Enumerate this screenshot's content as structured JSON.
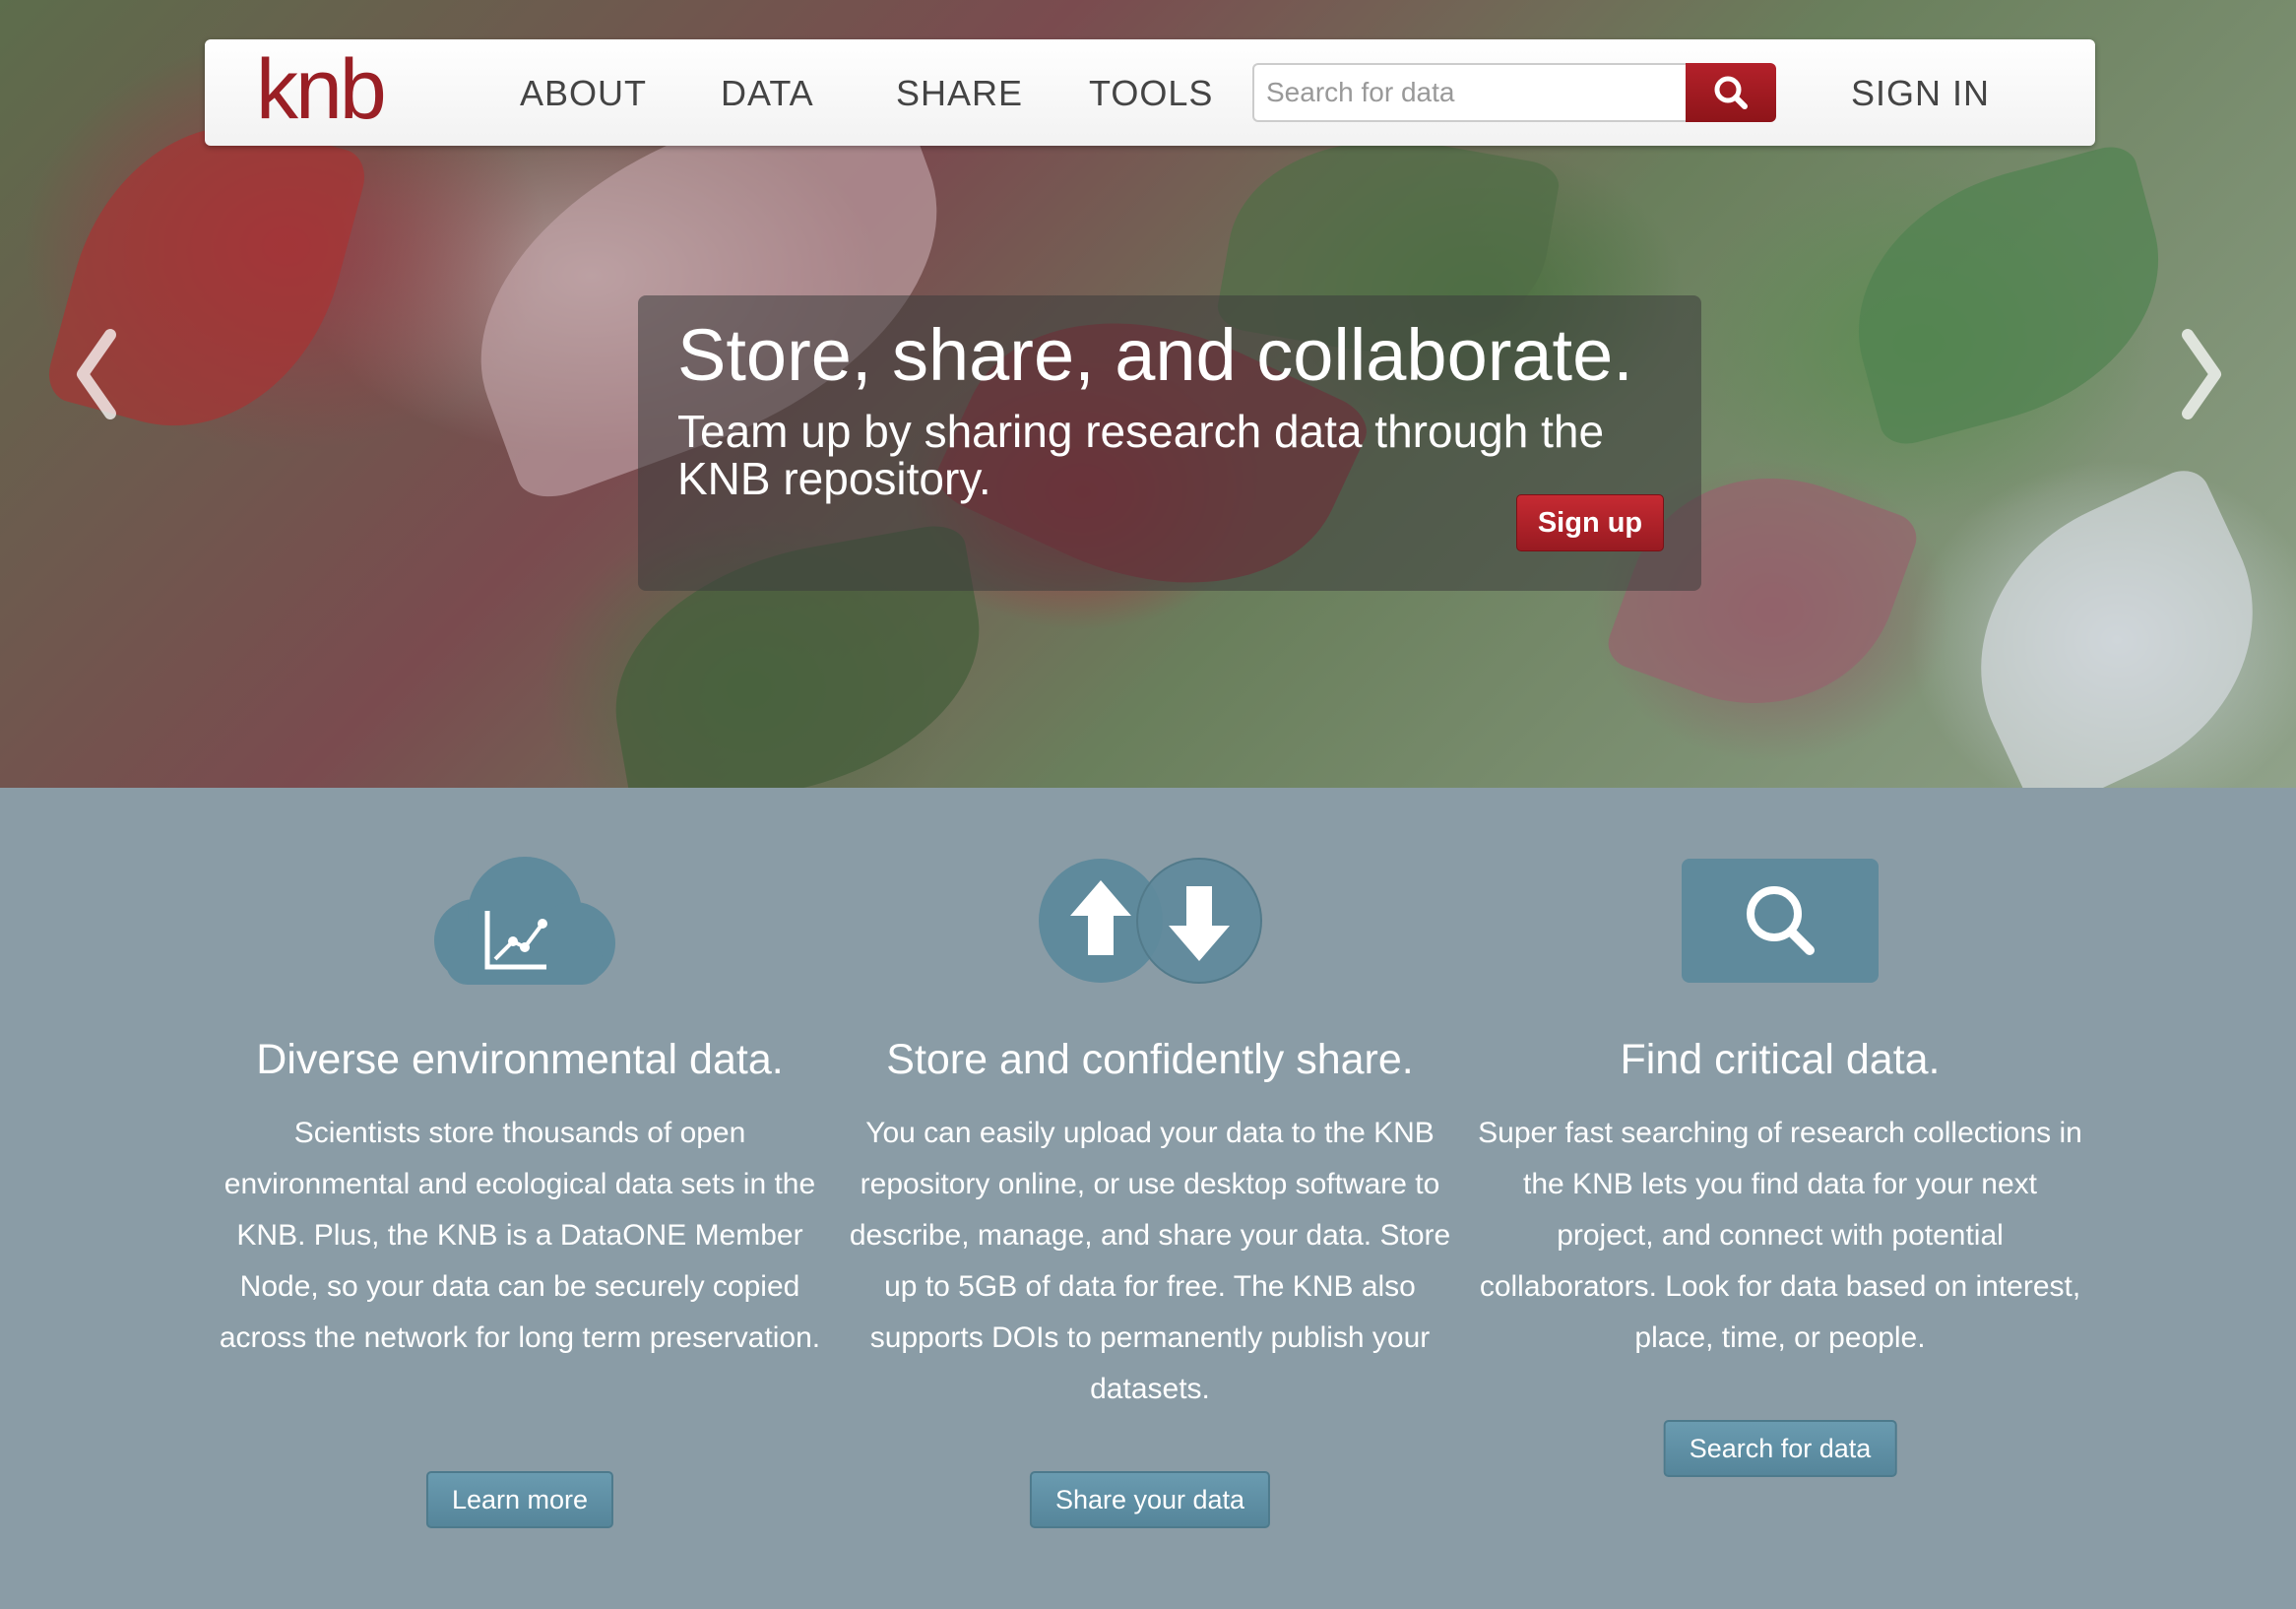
{
  "brand": {
    "logo_text": "knb",
    "accent_color": "#9a1f25"
  },
  "nav": {
    "items": [
      {
        "label": "ABOUT"
      },
      {
        "label": "DATA"
      },
      {
        "label": "SHARE"
      },
      {
        "label": "TOOLS"
      }
    ],
    "search_placeholder": "Search for data",
    "search_icon": "search-icon",
    "sign_in_label": "SIGN IN"
  },
  "hero": {
    "title": "Store, share, and collaborate.",
    "subtitle": "Team up by sharing research data through the KNB repository.",
    "signup_label": "Sign up",
    "prev_icon": "chevron-left-icon",
    "next_icon": "chevron-right-icon"
  },
  "features": [
    {
      "icon": "cloud-chart-icon",
      "title": "Diverse environmental data.",
      "text": "Scientists store thousands of open environmental and ecological data sets in the KNB. Plus, the KNB is a DataONE Member Node, so your data can be securely copied across the network for long term preservation.",
      "button_label": "Learn more"
    },
    {
      "icon": "upload-download-icon",
      "title": "Store and confidently share.",
      "text": "You can easily upload your data to the KNB repository online, or use desktop software to describe, manage, and share your data. Store up to 5GB of data for free. The KNB also supports DOIs to permanently publish your datasets.",
      "button_label": "Share your data"
    },
    {
      "icon": "search-icon",
      "title": "Find critical data.",
      "text": "Super fast searching of research collections in the KNB lets you find data for your next project, and connect with potential collaborators. Look for data based on interest, place, time, or people.",
      "button_label": "Search for data"
    }
  ],
  "colors": {
    "feature_bg": "#8a9ca6",
    "feature_icon": "#5f8a9c",
    "button_bg": "#5f8fa3"
  }
}
